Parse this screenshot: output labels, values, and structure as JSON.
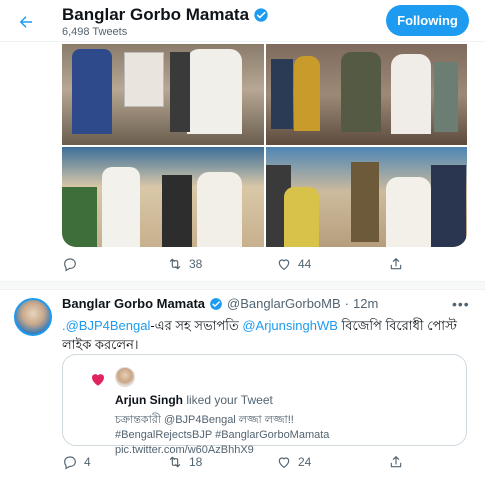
{
  "header": {
    "name": "Banglar Gorbo Mamata",
    "tweet_count": "6,498 Tweets",
    "follow_label": "Following"
  },
  "tweet1": {
    "reply_count": "",
    "retweet_count": "38",
    "like_count": "44"
  },
  "tweet2": {
    "name": "Banglar Gorbo Mamata",
    "handle": "@BanglarGorboMB",
    "separator": "·",
    "time": "12m",
    "mention1": ".@BJP4Bengal",
    "text_part1": "-এর সহ সভাপতি ",
    "mention2": "@ArjunsinghWB",
    "text_part2": " বিজেপি বিরোধী পোস্ট লাইক করলেন।",
    "embed": {
      "liker_name": "Arjun Singh",
      "liked_text": " liked your Tweet",
      "quoted_text": "চক্রান্তকারী @BJP4Bengal লজ্জা লজ্জা!!",
      "quoted_tags": "#BengalRejectsBJP #BanglarGorboMamata pic.twitter.com/w60AzBhhX9"
    },
    "reply_count": "4",
    "retweet_count": "18",
    "like_count": "24"
  },
  "colors": {
    "accent": "#1d9bf0",
    "like_red": "#e0245e",
    "muted": "#536471"
  },
  "icons": [
    "back-arrow-icon",
    "verified-badge-icon",
    "reply-icon",
    "retweet-icon",
    "like-icon",
    "share-icon",
    "more-icon",
    "heart-icon"
  ]
}
